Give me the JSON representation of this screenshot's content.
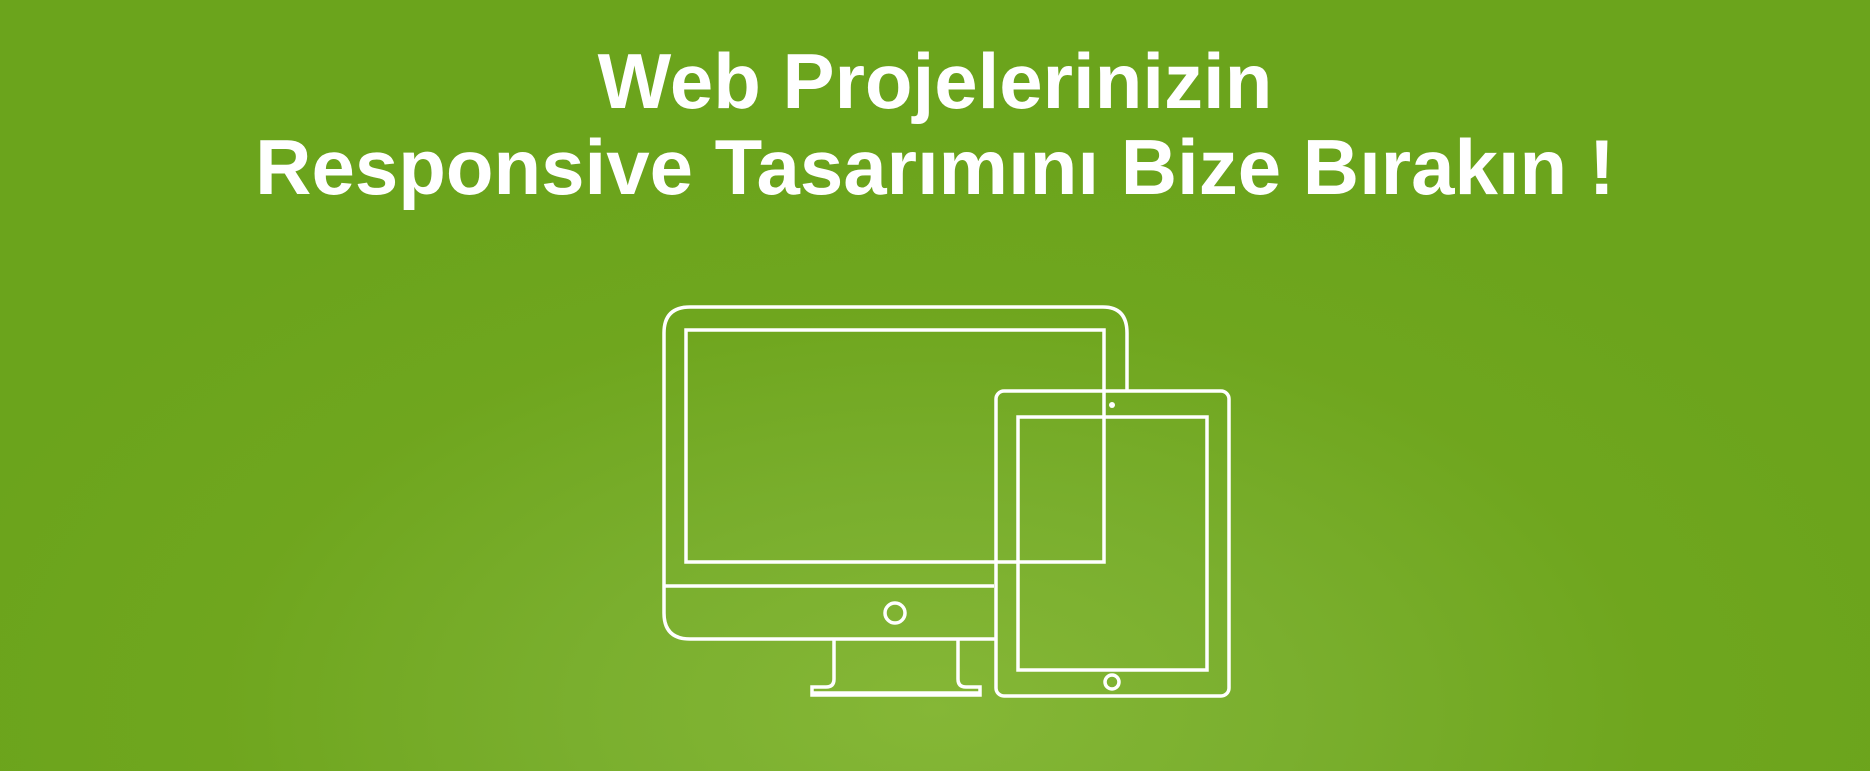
{
  "headline": {
    "line1": "Web Projelerinizin",
    "line2": "Responsive Tasarımını Bize Bırakın !"
  },
  "illustration": {
    "icons": [
      "desktop-monitor-icon",
      "tablet-icon"
    ]
  },
  "colors": {
    "background": "#6fa61e",
    "foreground": "#ffffff"
  }
}
